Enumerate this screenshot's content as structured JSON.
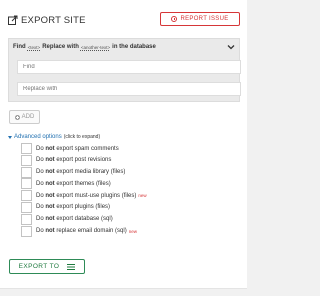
{
  "header": {
    "title": "EXPORT SITE",
    "report_label": "REPORT ISSUE"
  },
  "find_replace": {
    "title_prefix": "Find",
    "token_text": "<text>",
    "title_middle": "Replace with",
    "token_another": "<another-text>",
    "title_suffix": "in the database",
    "find_placeholder": "Find",
    "replace_placeholder": "Replace with"
  },
  "add_label": "ADD",
  "advanced": {
    "label": "Advanced options",
    "hint": "(click to expand)"
  },
  "options": [
    {
      "prefix": "Do",
      "strong": "not",
      "rest": "export spam comments",
      "new": ""
    },
    {
      "prefix": "Do",
      "strong": "not",
      "rest": "export post revisions",
      "new": ""
    },
    {
      "prefix": "Do",
      "strong": "not",
      "rest": "export media library (files)",
      "new": ""
    },
    {
      "prefix": "Do",
      "strong": "not",
      "rest": "export themes (files)",
      "new": ""
    },
    {
      "prefix": "Do",
      "strong": "not",
      "rest": "export must-use plugins (files)",
      "new": "new"
    },
    {
      "prefix": "Do",
      "strong": "not",
      "rest": "export plugins (files)",
      "new": ""
    },
    {
      "prefix": "Do",
      "strong": "not",
      "rest": "export database (sql)",
      "new": ""
    },
    {
      "prefix": "Do",
      "strong": "not",
      "rest": "replace email domain (sql)",
      "new": "new"
    }
  ],
  "export_to_label": "EXPORT TO",
  "colors": {
    "accent_red": "#d63638",
    "accent_green": "#1f7a3f",
    "link_blue": "#2271b1"
  }
}
